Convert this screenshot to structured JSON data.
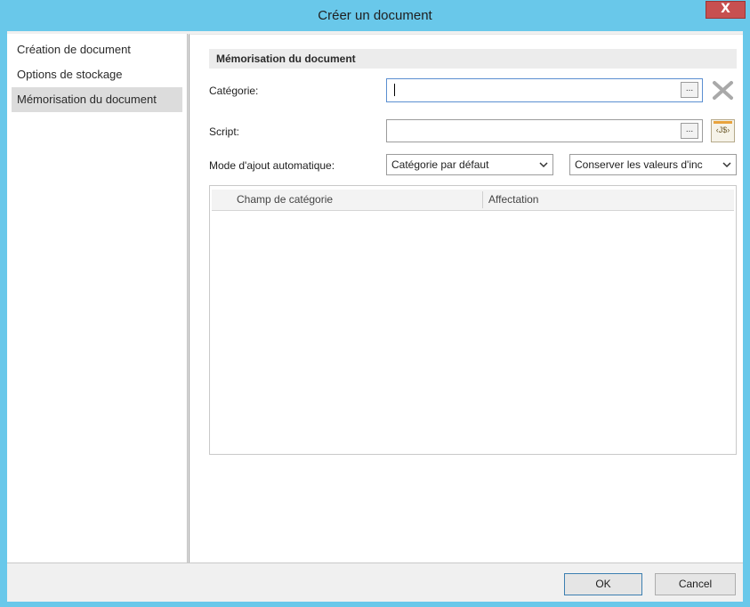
{
  "window": {
    "title": "Créer un document",
    "close_label": "X"
  },
  "nav": {
    "items": [
      {
        "label": "Création de document"
      },
      {
        "label": "Options de stockage"
      },
      {
        "label": "Mémorisation du document",
        "selected": true
      }
    ]
  },
  "section": {
    "title": "Mémorisation du document",
    "category_label": "Catégorie:",
    "category_value": "",
    "script_label": "Script:",
    "script_value": "",
    "browse_label": "...",
    "js_label": "‹J$›",
    "mode_label": "Mode d'ajout automatique:",
    "mode_value": "Catégorie par défaut",
    "keep_value": "Conserver les valeurs d'inc"
  },
  "grid": {
    "columns": [
      "Champ de catégorie",
      "Affectation"
    ],
    "rows": []
  },
  "footer": {
    "ok_label": "OK",
    "cancel_label": "Cancel"
  },
  "colors": {
    "titlebar": "#69c8ea",
    "close": "#c75050",
    "nav_selected": "#dcdcdc"
  },
  "icons": {
    "clear": "x-icon",
    "script": "js-script-icon",
    "dropdown": "chevron-down-icon"
  }
}
